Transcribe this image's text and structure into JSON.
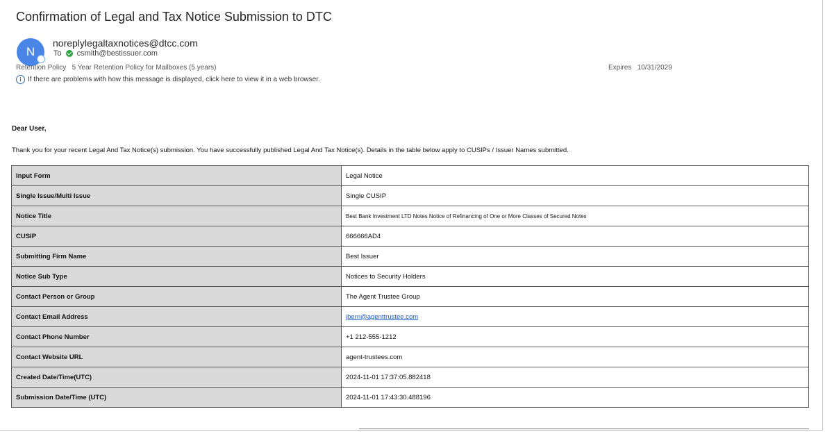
{
  "email": {
    "subject": "Confirmation of Legal and Tax Notice Submission to DTC",
    "avatar_initial": "N",
    "sender": "noreplylegaltaxnotices@dtcc.com",
    "to_label": "To",
    "to_address": "csmith@bestissuer.com",
    "retention_label": "Retention Policy",
    "retention_value": "5 Year Retention Policy for Mailboxes (5 years)",
    "expires_label": "Expires",
    "expires_value": "10/31/2029",
    "info_text": "If there are problems with how this message is displayed, click here to view it in a web browser."
  },
  "body": {
    "greeting": "Dear User,",
    "intro": "Thank you for your recent Legal And Tax Notice(s) submission. You have successfully published Legal And Tax Notice(s). Details in the table below apply to CUSIPs / Issuer Names submitted."
  },
  "table": {
    "rows": [
      {
        "label": "Input Form",
        "value": "Legal Notice"
      },
      {
        "label": "Single Issue/Multi Issue",
        "value": "Single CUSIP"
      },
      {
        "label": "Notice Title",
        "value": "Best Bank Investment LTD Notes Notice of Refinancing of One or More Classes of Secured Notes"
      },
      {
        "label": "CUSIP",
        "value": "666666AD4"
      },
      {
        "label": "Submitting Firm Name",
        "value": "Best Issuer"
      },
      {
        "label": "Notice Sub Type",
        "value": "Notices to Security Holders"
      },
      {
        "label": "Contact Person or Group",
        "value": "The Agent Trustee Group"
      },
      {
        "label": "Contact Email Address",
        "value": "jbern@agenttrustee.com"
      },
      {
        "label": "Contact Phone Number",
        "value": "+1 212-555-1212"
      },
      {
        "label": "Contact Website URL",
        "value": "agent-trustees.com"
      },
      {
        "label": "Created Date/Time(UTC)",
        "value": "2024-11-01 17:37:05.882418"
      },
      {
        "label": "Submission Date/Time (UTC)",
        "value": "2024-11-01 17:43:30.488196"
      }
    ]
  },
  "colors": {
    "avatar": "#4a86e8",
    "label_cell": "#d9d9d9",
    "link": "#1a56c4",
    "verified": "#2ea043"
  }
}
